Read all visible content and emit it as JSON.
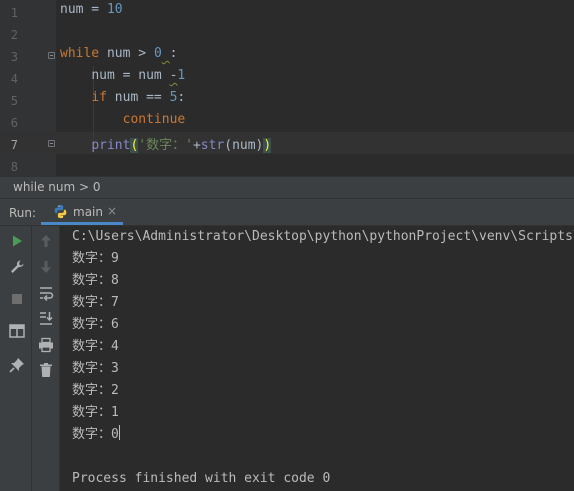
{
  "editor": {
    "line_numbers": [
      "1",
      "2",
      "3",
      "4",
      "5",
      "6",
      "7",
      "8"
    ],
    "active_line": "7",
    "line1": {
      "var": "num",
      "op": " = ",
      "val": "10"
    },
    "line3": {
      "kw": "while",
      "cond": " num > ",
      "val": "0",
      "space": " ",
      "colon": ":"
    },
    "line4": {
      "indent": "    ",
      "lhs": "num = num ",
      "minus": "-",
      "val": "1"
    },
    "line5": {
      "indent": "    ",
      "kw": "if",
      "cond": " num == ",
      "val": "5",
      "colon": ":"
    },
    "line6": {
      "indent": "        ",
      "kw": "continue"
    },
    "line7": {
      "indent": "    ",
      "func": "print",
      "open": "(",
      "str": "'数字：'",
      "plus": "+",
      "func2": "str",
      "arg": "(num)",
      "close": ")"
    }
  },
  "breadcrumb": {
    "text": "while num > 0"
  },
  "run": {
    "title": "Run:",
    "tab_label": "main",
    "tab_close": "×",
    "colors": {
      "accent": "#4a88c7",
      "run_green": "#499c54",
      "python_blue": "#3d7ab8",
      "python_yellow": "#f5c842"
    },
    "toolbar_icons": [
      "run-icon",
      "wrench-icon",
      "stop-icon",
      "layout-icon",
      "pin-icon",
      "up-arrow-icon",
      "down-arrow-icon",
      "soft-wrap-icon",
      "scroll-to-end-icon",
      "print-icon",
      "trash-icon"
    ]
  },
  "console": {
    "command": "C:\\Users\\Administrator\\Desktop\\python\\pythonProject\\venv\\Scripts\\python.exe",
    "lines": [
      "数字：9",
      "数字：8",
      "数字：7",
      "数字：6",
      "数字：4",
      "数字：3",
      "数字：2",
      "数字：1"
    ],
    "last_line": "数字：0",
    "exit": "Process finished with exit code 0"
  }
}
